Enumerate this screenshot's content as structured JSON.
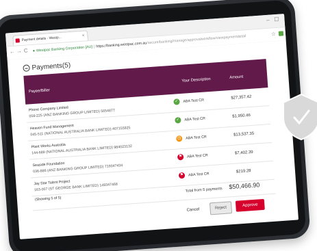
{
  "browser": {
    "tab_title": "Payment details - Westp...",
    "tab_close": "×",
    "win_min": "–",
    "win_max": "☐",
    "nav_back": "←",
    "nav_forward": "→",
    "nav_reload": "C",
    "url_ev": "Westpac Banking Corporation [AU]",
    "url_sep": "|",
    "url_host": "https://banking.westpac.com.au",
    "url_path": "/secure/banking/manage/approvalworkflow/viewpaymentdetail",
    "bookmark": "☆"
  },
  "page": {
    "title": "Payments(5)",
    "columns": {
      "payee": "Payee/Biller",
      "description": "Your Description",
      "amount": "Amount"
    },
    "rows": [
      {
        "payee": "Phone Company Limited",
        "account": "058-225 (ANZ BANKING GROUP LIMITED) 5654877",
        "description": "ABA Test CR",
        "amount": "$27,357.42",
        "status_color": "#5aa642",
        "status_icon": "approved-thumb-icon"
      },
      {
        "payee": "Heaven Fund Management",
        "account": "045-511 (NATIONAL AUSTRALIA BANK LIMITED) 407155925",
        "description": "ABA Test CR",
        "amount": "$1,950.46",
        "status_color": "#5aa642",
        "status_icon": "approved-thumb-icon"
      },
      {
        "payee": "Plant Works Australia",
        "account": "144-689 (NATIONAL AUSTRALIA BANK LIMITED) 984023132",
        "description": "ABA Test CR",
        "amount": "$13,537.35",
        "status_color": "#f39a1e",
        "status_icon": "pending-clock-icon"
      },
      {
        "payee": "Seaside Foundation",
        "account": "036-886 (ANZ BANKING GROUP LIMITED) 719347434",
        "description": "ABA Test CR",
        "amount": "$7,402.39",
        "status_color": "#d5002b",
        "status_icon": "flag-icon"
      },
      {
        "payee": "Jay Star Talent Project",
        "account": "163-007 (ST GEORGE BANK LIMITED) 149347468",
        "description": "ABA Test CR",
        "amount": "$219.28",
        "status_color": "#d5002b",
        "status_icon": "flag-icon"
      }
    ],
    "showing": "(Showing 5 of 5)",
    "total_label": "Total from 5 payments",
    "total_value": "$50,466.90",
    "cancel": "Cancel",
    "reject": "Reject",
    "approve": "Approve"
  },
  "colors": {
    "header": "#621a4b",
    "approve": "#d5002b",
    "shield": "#d9d9d9"
  }
}
